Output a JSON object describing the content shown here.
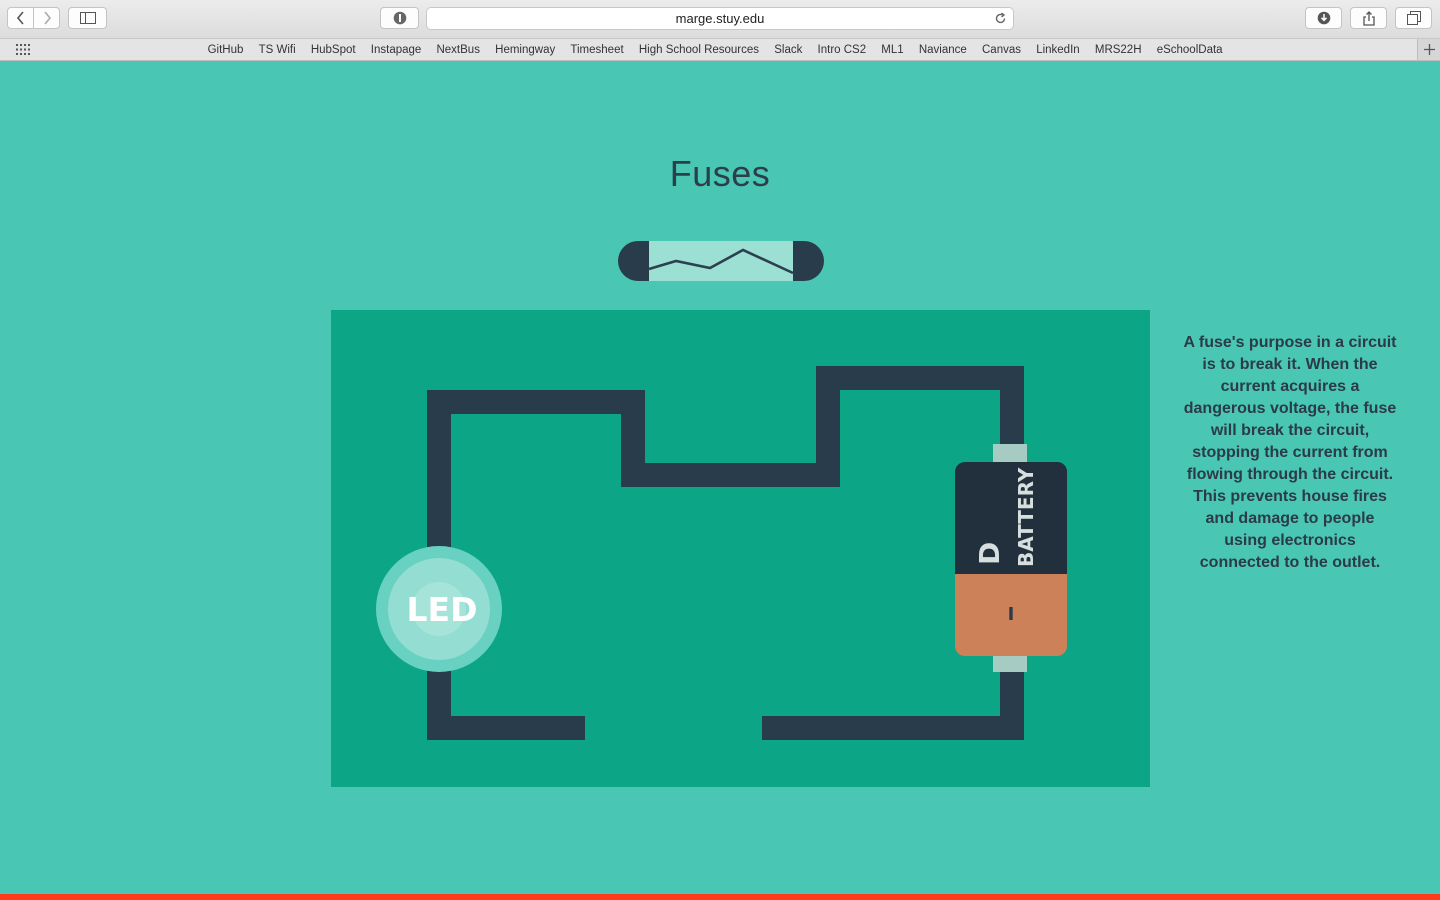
{
  "browser": {
    "url": "marge.stuy.edu",
    "bookmarks": [
      "GitHub",
      "TS Wifi",
      "HubSpot",
      "Instapage",
      "NextBus",
      "Hemingway",
      "Timesheet",
      "High School Resources",
      "Slack",
      "Intro CS2",
      "ML1",
      "Naviance",
      "Canvas",
      "LinkedIn",
      "MRS22H",
      "eSchoolData"
    ]
  },
  "page": {
    "title": "Fuses",
    "description": "A fuse's purpose in a circuit is to break it. When the current acquires a dangerous voltage, the fuse will break the circuit, stopping the current from flowing through the circuit. This prevents house fires and damage to people using electronics connected to the outlet."
  },
  "circuit": {
    "led_label": "LED",
    "battery_size": "D",
    "battery_label": "BATTERY",
    "battery_mark": "I"
  },
  "colors": {
    "background": "#49c6b4",
    "board": "#0ca687",
    "wire": "#293c4c",
    "battery_top": "#22303d",
    "battery_bottom": "#cc8158",
    "accent_bar": "#ff3b1c"
  }
}
